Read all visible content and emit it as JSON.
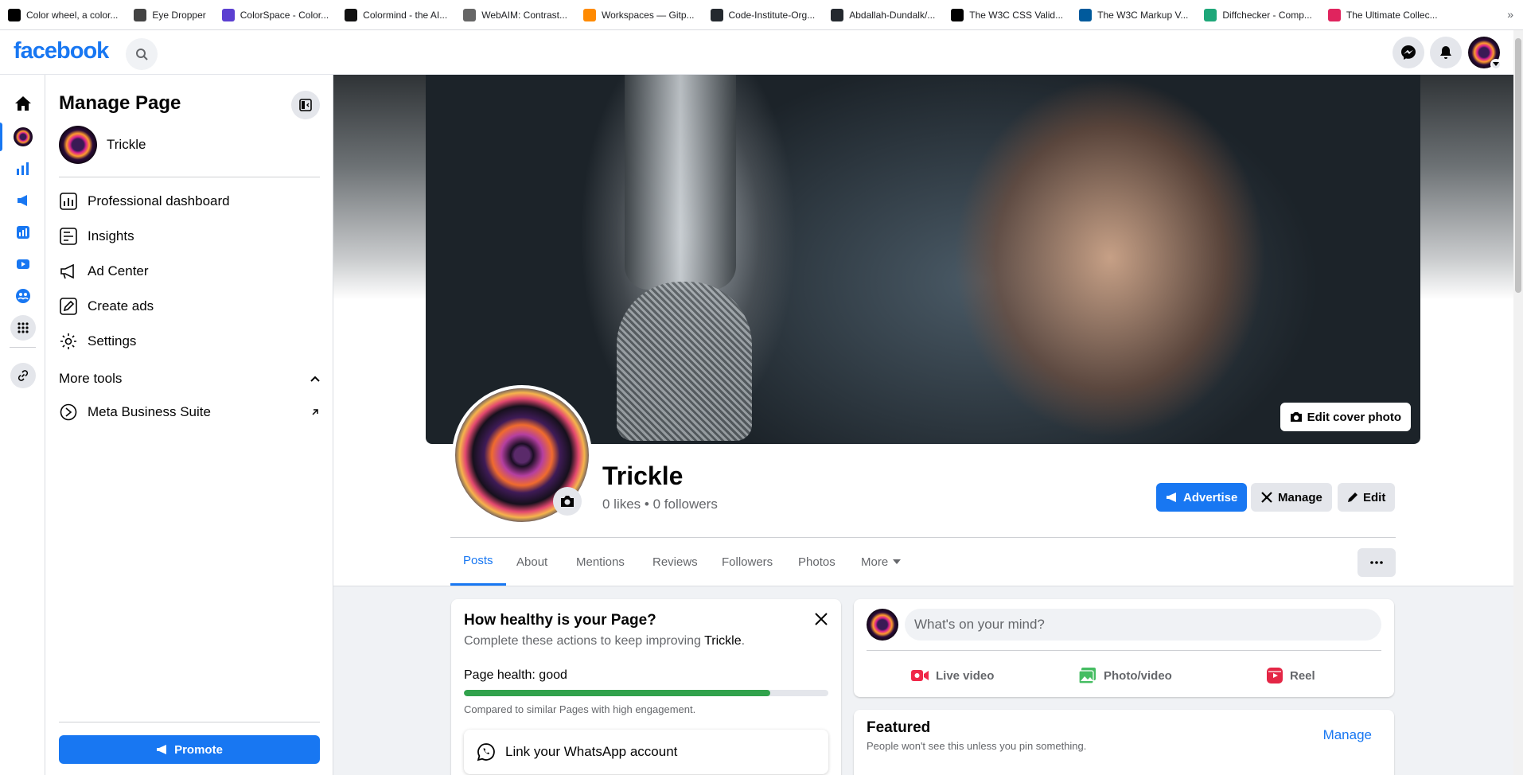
{
  "bookmarks": [
    {
      "label": "Color wheel, a color...",
      "icon": "colorwheel-icon",
      "color": "#000000"
    },
    {
      "label": "Eye Dropper",
      "icon": "eyedropper-icon",
      "color": "#444444"
    },
    {
      "label": "ColorSpace - Color...",
      "icon": "colorspace-icon",
      "color": "#5b3fd1"
    },
    {
      "label": "Colormind - the AI...",
      "icon": "colormind-icon",
      "color": "#111111"
    },
    {
      "label": "WebAIM: Contrast...",
      "icon": "webaim-icon",
      "color": "#666666"
    },
    {
      "label": "Workspaces — Gitp...",
      "icon": "gitpod-icon",
      "color": "#ff8a00"
    },
    {
      "label": "Code-Institute-Org...",
      "icon": "github-icon",
      "color": "#24292f"
    },
    {
      "label": "Abdallah-Dundalk/...",
      "icon": "github-icon",
      "color": "#24292f"
    },
    {
      "label": "The W3C CSS Valid...",
      "icon": "w3c-icon",
      "color": "#000000"
    },
    {
      "label": "The W3C Markup V...",
      "icon": "w3c-icon",
      "color": "#005a9c"
    },
    {
      "label": "Diffchecker - Comp...",
      "icon": "diffchecker-icon",
      "color": "#1ea779"
    },
    {
      "label": "The Ultimate Collec...",
      "icon": "collection-icon",
      "color": "#e0245e"
    }
  ],
  "bookmarks_more": "»",
  "brand": {
    "logo": "facebook",
    "accent": "#1877f2"
  },
  "manage": {
    "title": "Manage Page",
    "page_name": "Trickle",
    "menu": [
      {
        "label": "Professional dashboard",
        "icon": "dashboard-icon"
      },
      {
        "label": "Insights",
        "icon": "insights-icon"
      },
      {
        "label": "Ad Center",
        "icon": "megaphone-icon"
      },
      {
        "label": "Create ads",
        "icon": "pencil-icon"
      },
      {
        "label": "Settings",
        "icon": "gear-icon"
      }
    ],
    "more_tools_label": "More tools",
    "business_suite_label": "Meta Business Suite",
    "promote_label": "Promote"
  },
  "profile": {
    "name": "Trickle",
    "stats": "0 likes • 0 followers",
    "edit_cover_label": "Edit cover photo",
    "advertise_label": "Advertise",
    "manage_label": "Manage",
    "edit_label": "Edit"
  },
  "tabs": [
    "Posts",
    "About",
    "Mentions",
    "Reviews",
    "Followers",
    "Photos",
    "More"
  ],
  "health": {
    "title": "How healthy is your Page?",
    "subtitle_prefix": "Complete these actions to keep improving ",
    "subtitle_name": "Trickle",
    "subtitle_suffix": ".",
    "status": "Page health: good",
    "progress": 0.84,
    "note": "Compared to similar Pages with high engagement.",
    "whatsapp_label": "Link your WhatsApp account",
    "status_color": "#31a24c"
  },
  "composer": {
    "placeholder": "What's on your mind?",
    "live_label": "Live video",
    "photo_label": "Photo/video",
    "reel_label": "Reel"
  },
  "featured": {
    "title": "Featured",
    "subtitle": "People won't see this unless you pin something.",
    "manage_label": "Manage"
  }
}
